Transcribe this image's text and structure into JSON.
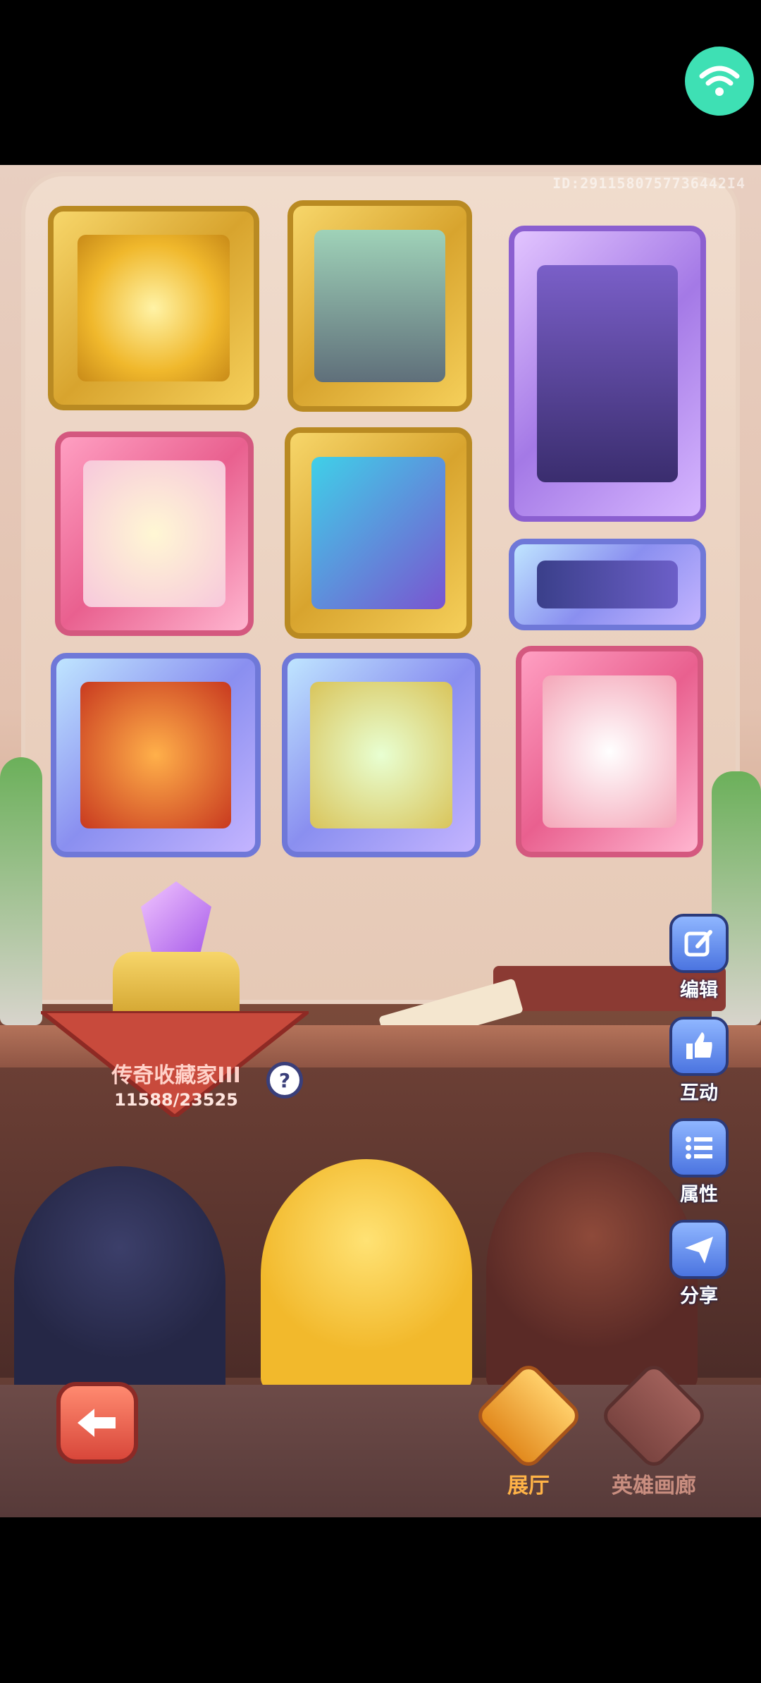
{
  "game_id": "ID:2911580757736442I4",
  "title": {
    "name": "传奇收藏家III",
    "progress": "11588/23525",
    "help": "?"
  },
  "side_buttons": [
    {
      "key": "edit",
      "label": "编辑"
    },
    {
      "key": "interact",
      "label": "互动"
    },
    {
      "key": "attributes",
      "label": "属性"
    },
    {
      "key": "share",
      "label": "分享"
    }
  ],
  "tabs": [
    {
      "label": "展厅",
      "active": true
    },
    {
      "label": "英雄画廊",
      "active": false
    }
  ],
  "colors": {
    "wifi": "#3ee0b4",
    "active_tab": "#ffb347",
    "inactive_tab": "#c98e80"
  }
}
